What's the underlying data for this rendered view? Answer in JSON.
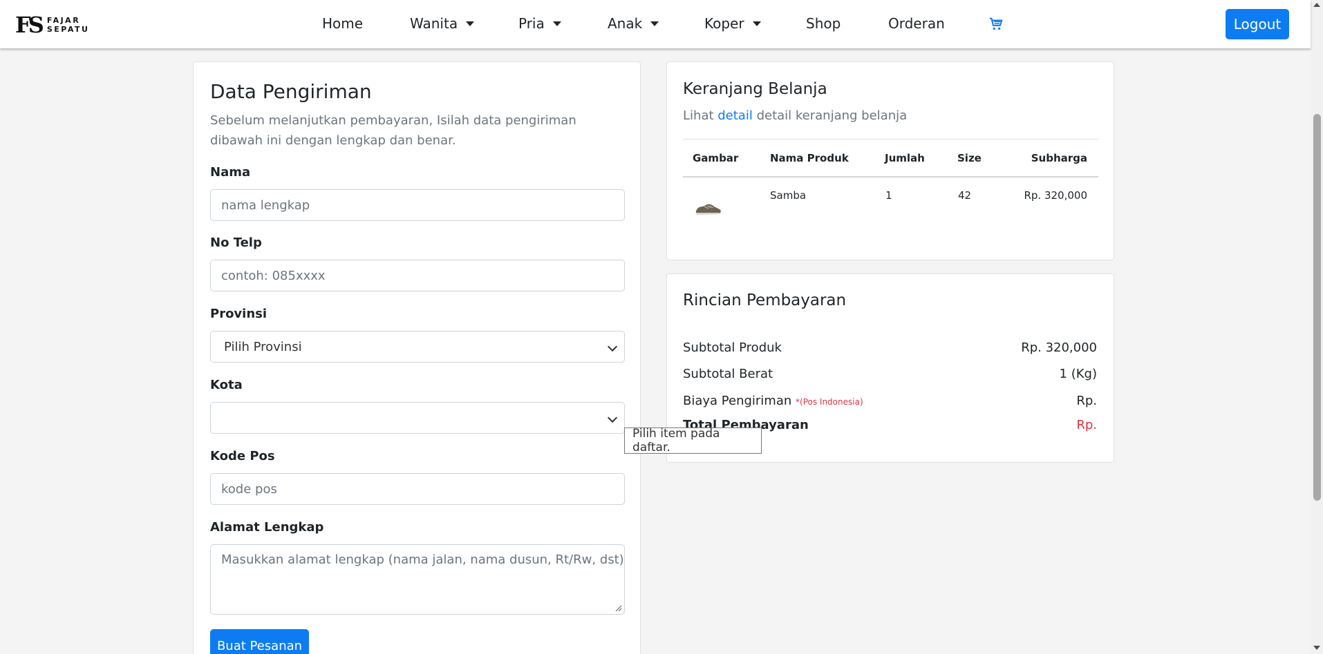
{
  "brand": {
    "mark": "FS",
    "line1": "FAJAR",
    "line2": "SEPATU"
  },
  "nav": {
    "items": [
      {
        "label": "Home"
      },
      {
        "label": "Wanita"
      },
      {
        "label": "Pria"
      },
      {
        "label": "Anak"
      },
      {
        "label": "Koper"
      },
      {
        "label": "Shop"
      },
      {
        "label": "Orderan"
      }
    ],
    "cart_icon": "cart-icon",
    "logout_label": "Logout"
  },
  "shipping": {
    "title": "Data Pengiriman",
    "subtitle": "Sebelum melanjutkan pembayaran, Isilah data pengiriman dibawah ini dengan lengkap dan benar.",
    "fields": {
      "nama": {
        "label": "Nama",
        "placeholder": "nama lengkap",
        "value": ""
      },
      "telp": {
        "label": "No Telp",
        "placeholder": "contoh: 085xxxx",
        "value": ""
      },
      "provinsi": {
        "label": "Provinsi",
        "selected": "Pilih Provinsi"
      },
      "kota": {
        "label": "Kota",
        "selected": ""
      },
      "kodepos": {
        "label": "Kode Pos",
        "placeholder": "kode pos",
        "value": ""
      },
      "alamat": {
        "label": "Alamat Lengkap",
        "placeholder": "Masukkan alamat lengkap (nama jalan, nama dusun, Rt/Rw, dst)",
        "value": ""
      }
    },
    "submit_label": "Buat Pesanan",
    "tooltip": "Pilih item pada daftar."
  },
  "cart": {
    "title": "Keranjang Belanja",
    "sub_prefix": "Lihat ",
    "sub_link": "detail",
    "sub_suffix": " detail keranjang belanja",
    "headers": [
      "Gambar",
      "Nama Produk",
      "Jumlah",
      "Size",
      "Subharga"
    ],
    "rows": [
      {
        "image": "shoe-image",
        "name": "Samba",
        "qty": "1",
        "size": "42",
        "subtotal": "Rp. 320,000"
      }
    ]
  },
  "payment": {
    "title": "Rincian Pembayaran",
    "subtotal_produk_label": "Subtotal Produk",
    "subtotal_produk_value": "Rp. 320,000",
    "subtotal_berat_label": "Subtotal Berat",
    "subtotal_berat_value": "1 (Kg)",
    "biaya_label": "Biaya Pengiriman",
    "biaya_courier": "*(Pos Indonesia)",
    "biaya_value": "Rp.",
    "total_label": "Total Pembayaran",
    "total_value": "Rp."
  },
  "colors": {
    "accent": "#0d7cf2",
    "danger": "#dc3545",
    "bg": "#f4f4f4"
  }
}
